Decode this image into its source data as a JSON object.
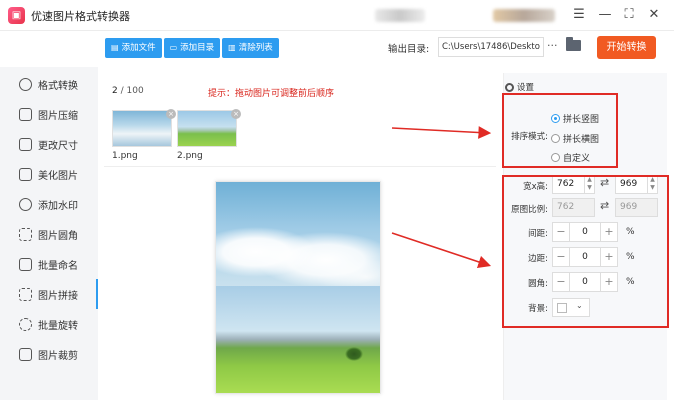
{
  "app": {
    "title": "优速图片格式转换器",
    "logo_glyph": "▣"
  },
  "window": {
    "menu_icon": "☰",
    "minimize_icon": "—",
    "maximize_icon": "⛶",
    "close_icon": "✕"
  },
  "toolbar": {
    "add_file_label": "添加文件",
    "add_folder_label": "添加目录",
    "clear_list_label": "清除列表",
    "output_label": "输出目录:",
    "output_path": "C:\\Users\\17486\\Deskto",
    "more_label": "···",
    "start_label": "开始转换",
    "colors": {
      "accent": "#2d9cf0",
      "start": "#f15a22"
    }
  },
  "sidebar": {
    "items": [
      {
        "label": "格式转换"
      },
      {
        "label": "图片压缩"
      },
      {
        "label": "更改尺寸"
      },
      {
        "label": "美化图片"
      },
      {
        "label": "添加水印"
      },
      {
        "label": "图片圆角"
      },
      {
        "label": "批量命名"
      },
      {
        "label": "图片拼接"
      },
      {
        "label": "批量旋转"
      },
      {
        "label": "图片裁剪"
      }
    ],
    "active": "图片拼接"
  },
  "main": {
    "count_current": "2",
    "count_total": "/ 100",
    "hint": "提示：拖动图片可调整前后顺序",
    "thumbs": [
      {
        "name": "1.png"
      },
      {
        "name": "2.png"
      }
    ],
    "remove_glyph": "×"
  },
  "settings": {
    "title": "设置",
    "sort_label": "排序模式:",
    "sort_options": [
      {
        "label": "拼长竖图",
        "selected": true
      },
      {
        "label": "拼长横图",
        "selected": false
      },
      {
        "label": "自定义",
        "selected": false
      }
    ],
    "size_label": "宽x高:",
    "width": "762",
    "height": "969",
    "orig_ratio_label": "原图比例:",
    "orig_width": "762",
    "orig_height": "969",
    "gap_label": "间距:",
    "gap_value": "0",
    "margin_label": "边距:",
    "margin_value": "0",
    "radius_label": "圆角:",
    "radius_value": "0",
    "percent": "%",
    "bg_label": "背景:",
    "minus": "−",
    "plus": "+",
    "swap_glyph": "⇄",
    "highlight_color": "#e02b25"
  }
}
